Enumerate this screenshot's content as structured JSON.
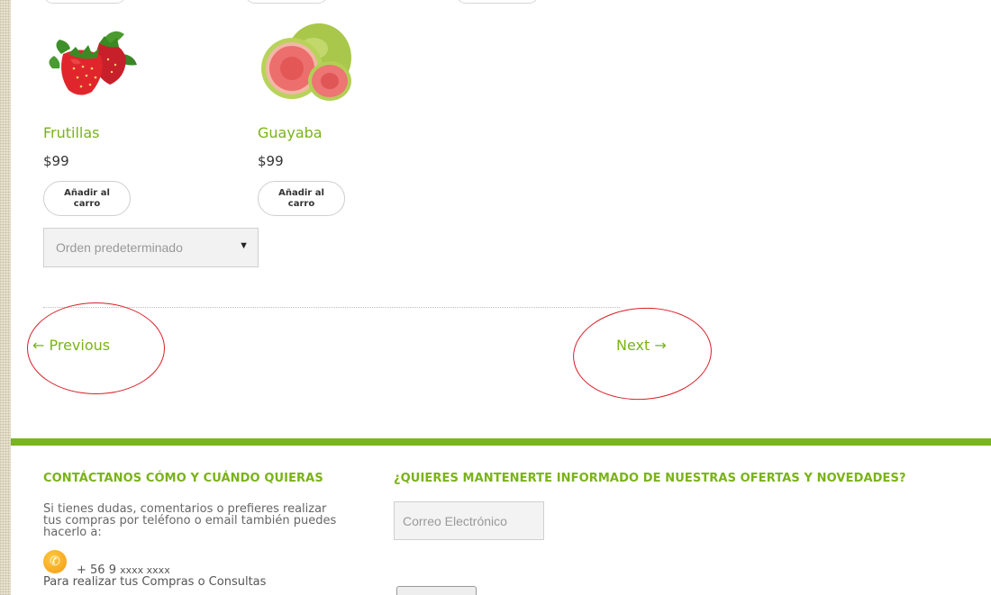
{
  "products": [
    {
      "name": "Frutillas",
      "price": "$99",
      "button": "Añadir al carro",
      "image": "strawberries-image"
    },
    {
      "name": "Guayaba",
      "price": "$99",
      "button": "Añadir al carro",
      "image": "guava-image"
    }
  ],
  "sort": {
    "selected": "Orden predeterminado"
  },
  "pagination": {
    "previous": "← Previous",
    "next": "Next →"
  },
  "footer": {
    "contact_title": "CONTÁCTANOS CÓMO Y CUÁNDO QUIERAS",
    "contact_text": "Si tienes dudas, comentarios o prefieres realizar tus compras por teléfono o email también puedes hacerlo a:",
    "phone_prefix": "+ 56 9",
    "phone_number": "xxxx xxxx",
    "phone_note": "Para realizar tus Compras o Consultas",
    "newsletter_title": "¿QUIERES MANTENERTE INFORMADO DE NUESTRAS OFERTAS Y NOVEDADES?",
    "email_placeholder": "Correo Electrónico"
  },
  "colors": {
    "accent": "#7ab317",
    "footer_bar": "#79b51c",
    "annotation": "#d81f26"
  }
}
